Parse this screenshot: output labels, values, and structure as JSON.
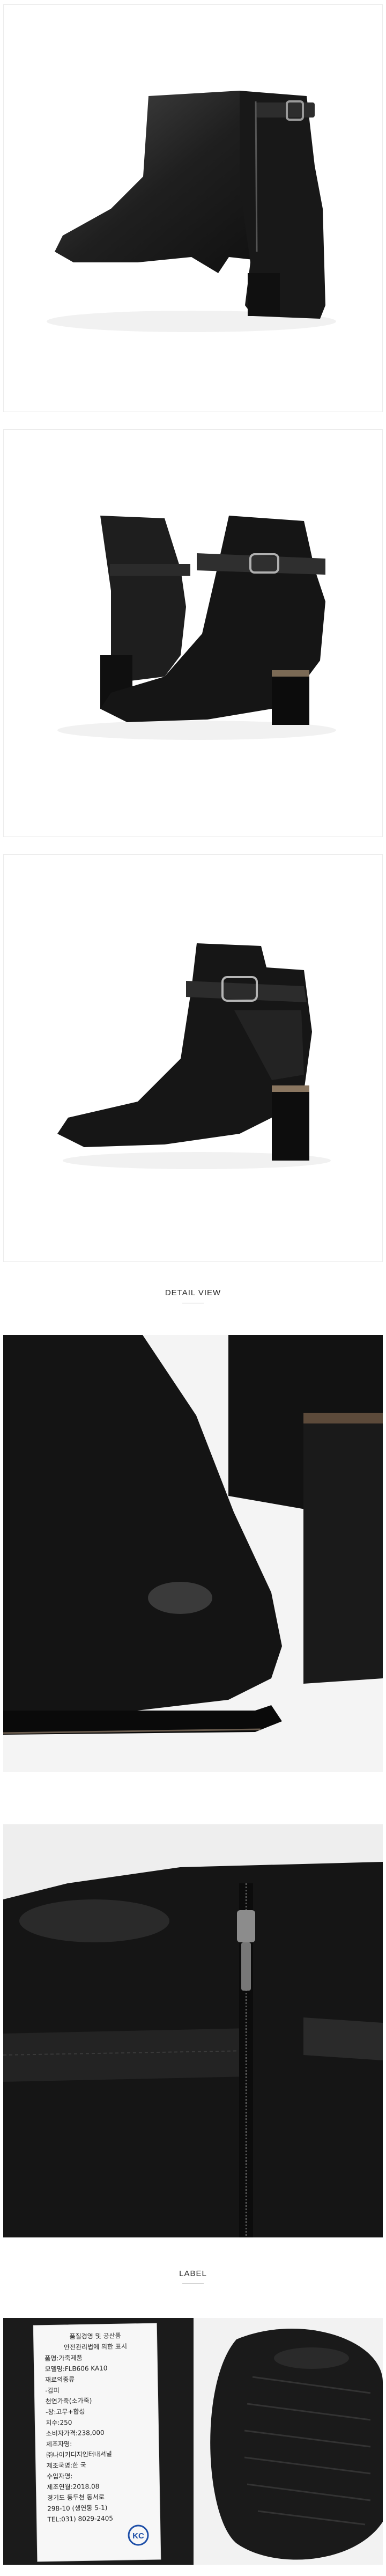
{
  "sections": {
    "detail_title": "DETAIL VIEW",
    "label_title": "LABEL"
  },
  "label": {
    "lines": [
      "품질경영 및 공산품",
      "안전관리법에 의한 표시",
      "품명:가죽제품",
      "모델명:FLB606 KA10",
      "재료의종류",
      "-갑피",
      "천연가죽(소가죽)",
      "-창:고무+합성",
      "치수:250",
      "소비자가격:238,000",
      "제조자명:",
      "㈜나이키디지인터내셔널",
      "제조국명:한 국",
      "수입자명:",
      "제조연월:2018.08",
      "경기도 동두천 동서로",
      "298-10 (생연동 5-1)",
      "TEL:031) 8029-2405"
    ],
    "mark": "KC"
  },
  "colors": {
    "leather": "#1c1c1c",
    "leather_highlight": "#5a5a5a",
    "background": "#ffffff"
  }
}
